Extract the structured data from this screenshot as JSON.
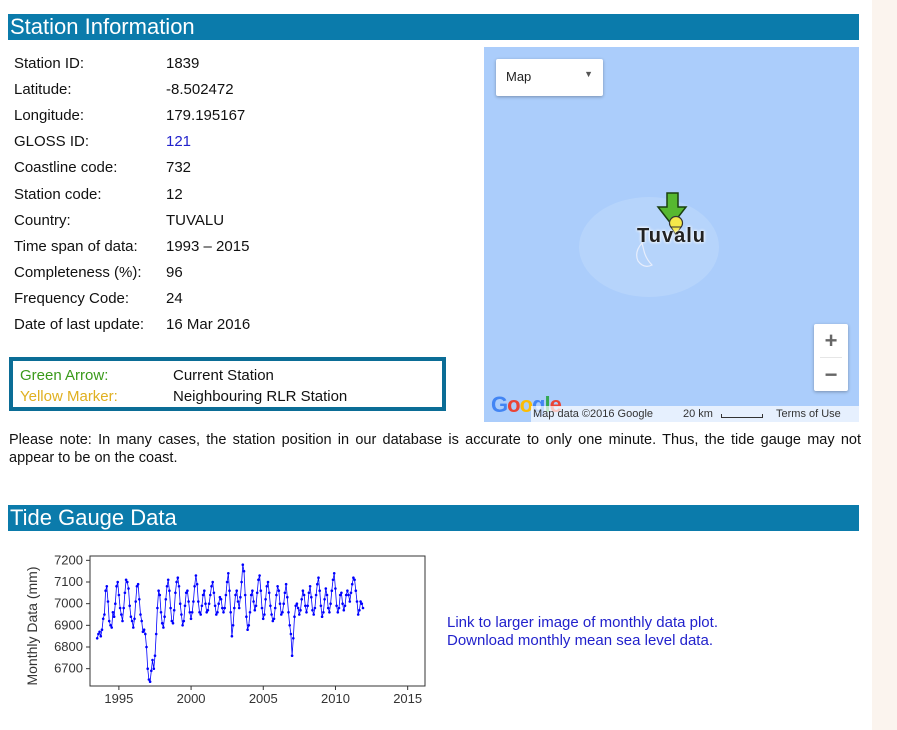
{
  "station_info": {
    "title": "Station Information",
    "fields": [
      {
        "label": "Station ID:",
        "value": "1839"
      },
      {
        "label": "Latitude:",
        "value": "-8.502472"
      },
      {
        "label": "Longitude:",
        "value": "179.195167"
      },
      {
        "label": "GLOSS ID:",
        "value": "121"
      },
      {
        "label": "Coastline code:",
        "value": "732"
      },
      {
        "label": "Station code:",
        "value": "12"
      },
      {
        "label": "Country:",
        "value": "TUVALU"
      },
      {
        "label": "Time span of data:",
        "value": "1993 – 2015"
      },
      {
        "label": "Completeness (%):",
        "value": "96"
      },
      {
        "label": "Frequency Code:",
        "value": "24"
      },
      {
        "label": "Date of last update:",
        "value": "16 Mar 2016"
      }
    ]
  },
  "legend": {
    "green_label": "Green Arrow:",
    "green_value": "Current Station",
    "yellow_label": "Yellow Marker:",
    "yellow_value": "Neighbouring RLR Station",
    "green_color": "#3a9a1a",
    "yellow_color": "#e0b020"
  },
  "note": "Please note: In many cases, the station position in our database is accurate to only one minute. Thus, the tide gauge may not appear to be on the coast.",
  "map": {
    "type_selector": "Map",
    "place_label": "Tuvalu",
    "logo": "Google",
    "attribution": "Map data ©2016 Google",
    "scale": "20 km",
    "terms": "Terms of Use",
    "zoom_in": "+",
    "zoom_out": "−",
    "arrow_icon": "green-arrow-icon",
    "marker_icon": "yellow-marker-icon"
  },
  "tide": {
    "title": "Tide Gauge Data",
    "link_plot": "Link to larger image of monthly data plot.",
    "link_download": "Download monthly mean sea level data."
  },
  "colors": {
    "header_bg": "#0b7bab",
    "link": "#2222cc",
    "series": "#0000ff",
    "map_water": "#abcdfb"
  },
  "chart_data": {
    "type": "line",
    "title": "",
    "xlabel": "",
    "ylabel": "Monthly Data (mm)",
    "xlim": [
      1993,
      2016.2
    ],
    "ylim": [
      6620,
      7220
    ],
    "xticks": [
      1995,
      2000,
      2005,
      2010,
      2015
    ],
    "yticks": [
      6700,
      6800,
      6900,
      7000,
      7100,
      7200
    ],
    "grid": false,
    "start_year": 1993.5,
    "step_years": 0.0833,
    "values": [
      6840,
      6860,
      6870,
      6850,
      6880,
      6930,
      6950,
      7060,
      7080,
      7010,
      6920,
      6900,
      6890,
      6960,
      6940,
      7000,
      7080,
      7100,
      7040,
      6980,
      6950,
      6920,
      6980,
      7050,
      7110,
      7100,
      7070,
      6990,
      6940,
      6920,
      6890,
      6930,
      7010,
      7080,
      7090,
      7020,
      6950,
      6920,
      6870,
      6880,
      6860,
      6800,
      6700,
      6650,
      6640,
      6690,
      6740,
      6700,
      6760,
      6860,
      6980,
      7060,
      7040,
      6960,
      6910,
      6890,
      6940,
      7020,
      7080,
      7110,
      7060,
      6980,
      6920,
      6910,
      6970,
      7050,
      7100,
      7120,
      7080,
      7000,
      6950,
      6900,
      6920,
      6990,
      7050,
      7060,
      7010,
      6960,
      6930,
      6960,
      7010,
      7080,
      7130,
      7090,
      7010,
      6960,
      6950,
      6990,
      7040,
      7060,
      7000,
      6960,
      6970,
      7000,
      7040,
      7080,
      7100,
      7050,
      6990,
      6950,
      6960,
      7000,
      7030,
      7020,
      6980,
      6960,
      6980,
      7040,
      7100,
      7140,
      7060,
      6960,
      6850,
      6900,
      6980,
      7040,
      7060,
      7010,
      6980,
      7030,
      7100,
      7180,
      7150,
      7040,
      6940,
      6880,
      6900,
      6960,
      7040,
      7060,
      7010,
      6970,
      6990,
      7050,
      7110,
      7130,
      7060,
      6980,
      6930,
      6950,
      7020,
      7080,
      7100,
      7050,
      6990,
      6950,
      6920,
      6930,
      6980,
      7040,
      7080,
      7060,
      7000,
      6950,
      6960,
      7000,
      7050,
      7090,
      7030,
      6960,
      6900,
      6860,
      6760,
      6840,
      6940,
      6990,
      7000,
      6980,
      6950,
      6970,
      7020,
      7060,
      7040,
      6990,
      6960,
      6990,
      7050,
      7080,
      7030,
      6970,
      6950,
      6980,
      7040,
      7090,
      7120,
      7060,
      6990,
      6940,
      6960,
      7020,
      7070,
      7040,
      6980,
      6960,
      7000,
      7060,
      7110,
      7140,
      7070,
      6990,
      6960,
      6980,
      7040,
      7050,
      7000,
      6970,
      6990,
      7040,
      7060,
      7040,
      7010,
      7050,
      7090,
      7120,
      7110,
      7060,
      7010,
      6950,
      6970,
      7010,
      7000,
      6980
    ]
  }
}
